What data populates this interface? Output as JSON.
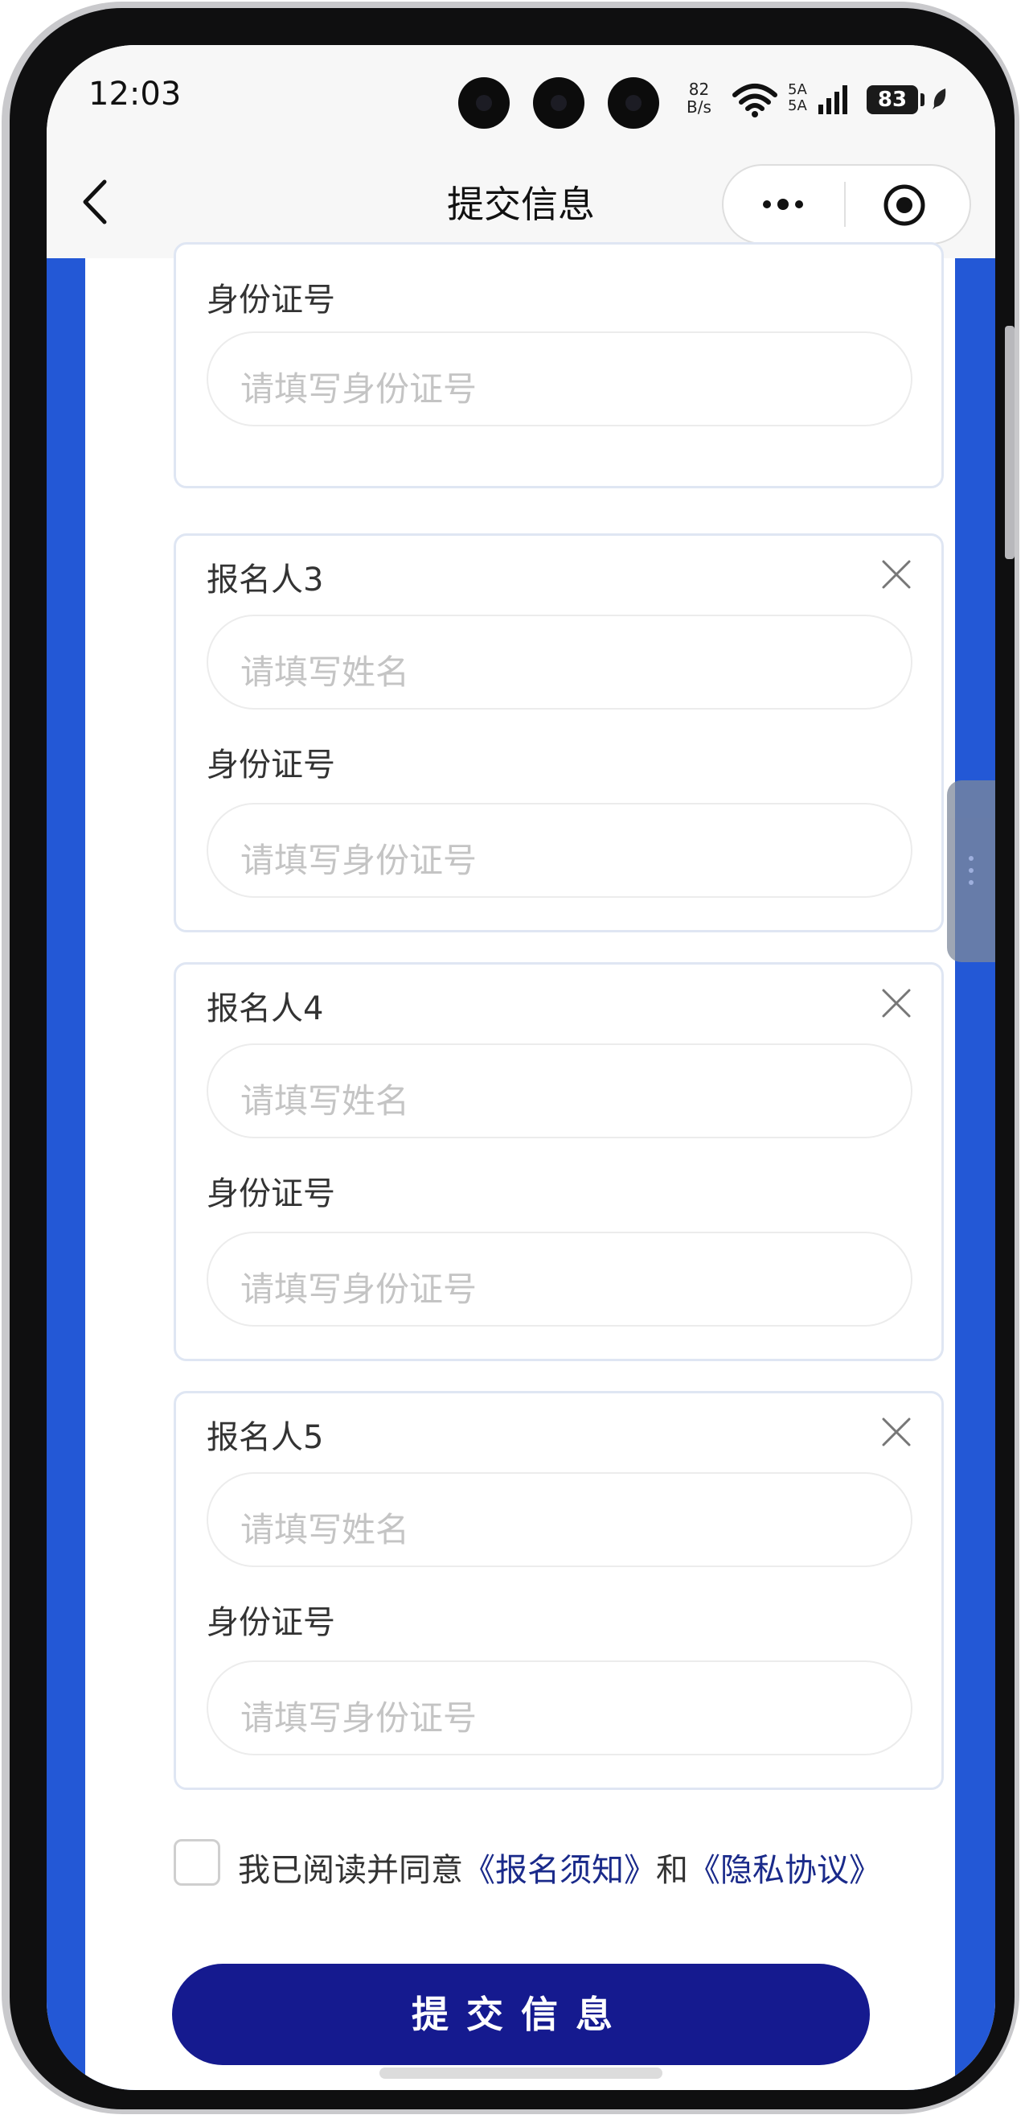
{
  "status_bar": {
    "time": "12:03",
    "net_speed_value": "82",
    "net_speed_unit": "B/s",
    "signal_label_1": "5A",
    "signal_label_2": "5A",
    "battery": "83"
  },
  "nav": {
    "title": "提交信息",
    "back_icon": "chevron-left-icon",
    "more_icon": "more-dots-icon",
    "close_icon": "target-circle-icon"
  },
  "form": {
    "partial_card": {
      "id_label": "身份证号",
      "id_placeholder": "请填写身份证号"
    },
    "applicants": [
      {
        "title": "报名人3",
        "name_placeholder": "请填写姓名",
        "id_label": "身份证号",
        "id_placeholder": "请填写身份证号"
      },
      {
        "title": "报名人4",
        "name_placeholder": "请填写姓名",
        "id_label": "身份证号",
        "id_placeholder": "请填写身份证号"
      },
      {
        "title": "报名人5",
        "name_placeholder": "请填写姓名",
        "id_label": "身份证号",
        "id_placeholder": "请填写身份证号"
      }
    ],
    "agreement": {
      "prefix": "我已阅读并同意",
      "link1": "《报名须知》",
      "conjunction": "和",
      "link2": "《隐私协议》",
      "checked": false
    },
    "submit_label": "提交信息"
  },
  "colors": {
    "accent_blue": "#2358d6",
    "button_navy": "#151a8f",
    "link_navy": "#1a2a8a"
  }
}
